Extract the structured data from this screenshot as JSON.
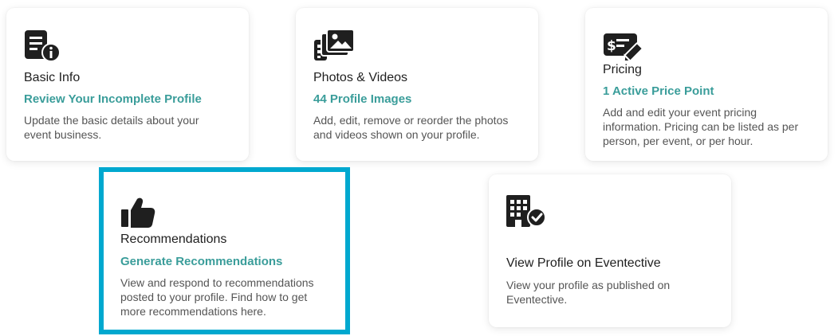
{
  "cards": {
    "basic_info": {
      "title": "Basic Info",
      "link": "Review Your Incomplete Profile",
      "description": "Update the basic details about your event business.",
      "icon": "document-info-icon"
    },
    "photos_videos": {
      "title": "Photos & Videos",
      "link": "44 Profile Images",
      "description": "Add, edit, remove or reorder the photos and videos shown on your profile.",
      "icon": "photo-gallery-icon"
    },
    "pricing": {
      "title": "Pricing",
      "link": "1 Active Price Point",
      "description": "Add and edit your event pricing information. Pricing can be listed as per person, per event, or per hour.",
      "icon": "price-edit-icon"
    },
    "recommendations": {
      "title": "Recommendations",
      "link": "Generate Recommendations",
      "description": "View and respond to recommendations posted to your profile. Find how to get more recommendations here.",
      "icon": "thumbs-up-icon"
    },
    "view_profile": {
      "title": "View Profile on Eventective",
      "description": "View your profile as published on Eventective.",
      "icon": "building-check-icon"
    }
  },
  "colors": {
    "accent": "#3a9d9a",
    "highlight_border": "#00a8cf",
    "icon": "#1f1f1f"
  }
}
